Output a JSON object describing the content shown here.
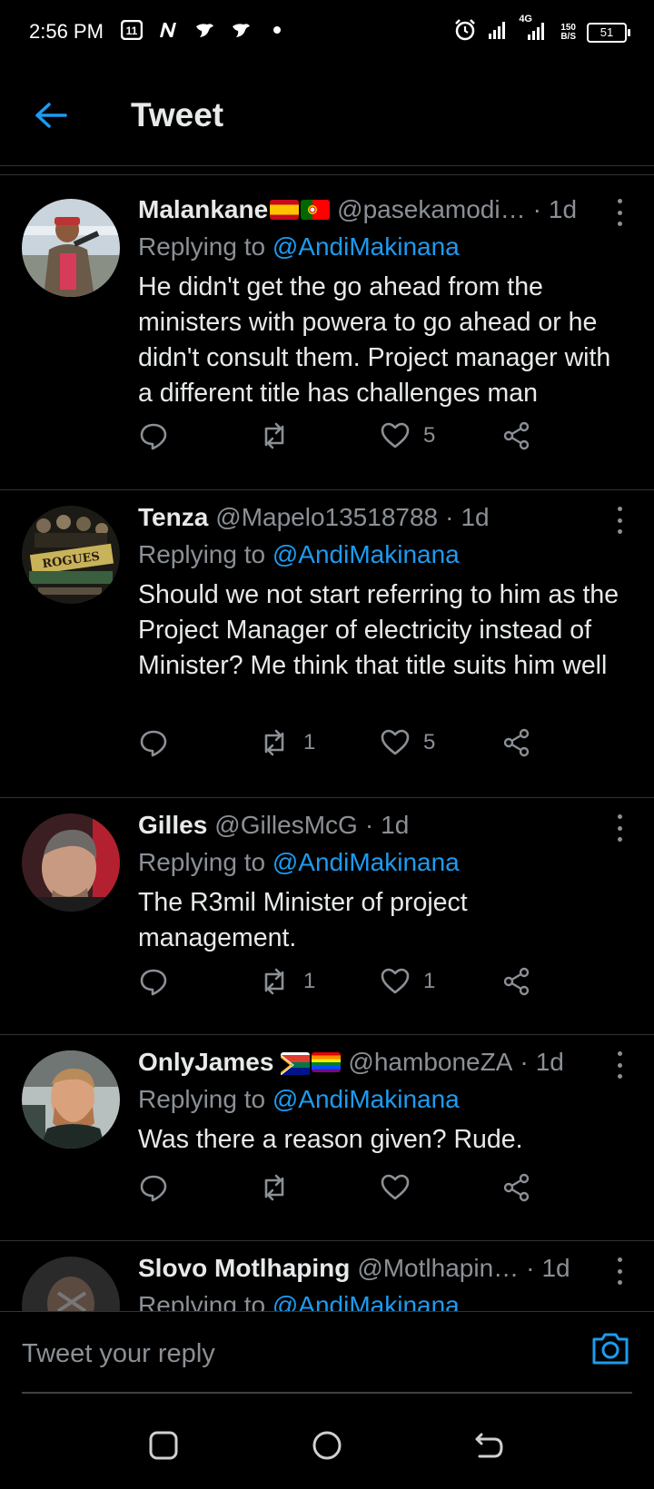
{
  "status_bar": {
    "time": "2:56 PM",
    "network": "4G",
    "net_speed_top": "150",
    "net_speed_bottom": "B/S",
    "battery": "51",
    "icons": [
      "app-notification-icon",
      "n-notification-icon",
      "bird-notification-icon",
      "bird-notification-icon",
      "dot-icon",
      "alarm-icon",
      "signal-icon",
      "signal-4g-icon",
      "battery-icon"
    ]
  },
  "header": {
    "title": "Tweet",
    "back_icon": "back-arrow-icon"
  },
  "colors": {
    "background": "#000000",
    "accent": "#1d9bf0",
    "secondary_text": "#8b9096",
    "divider": "#2f3336"
  },
  "tweets": [
    {
      "name": "Malankane",
      "flags": [
        "spain-flag",
        "portugal-flag"
      ],
      "handle": "@pasekamodi…",
      "age": "1d",
      "reply_prefix": "Replying to",
      "reply_to": "@AndiMakinana",
      "text": "He didn't get the go ahead from the ministers with powera to go ahead or he didn't consult them. Project manager with a different title has challenges man",
      "replies": "",
      "retweets": "",
      "likes": "5"
    },
    {
      "name": "Tenza",
      "flags": [],
      "handle": "@Mapelo13518788",
      "age": "1d",
      "reply_prefix": "Replying to",
      "reply_to": "@AndiMakinana",
      "text": "Should we not start referring to him as the Project Manager of electricity instead of Minister? Me think that title suits him well",
      "replies": "",
      "retweets": "1",
      "likes": "5"
    },
    {
      "name": "Gilles",
      "flags": [],
      "handle": "@GillesMcG",
      "age": "1d",
      "reply_prefix": "Replying to",
      "reply_to": "@AndiMakinana",
      "text": "The R3mil Minister of project management.",
      "replies": "",
      "retweets": "1",
      "likes": "1"
    },
    {
      "name": "OnlyJames",
      "flags": [
        "south-africa-flag",
        "rainbow-flag"
      ],
      "handle": "@hamboneZA",
      "age": "1d",
      "reply_prefix": "Replying to",
      "reply_to": "@AndiMakinana",
      "text": "Was there a reason given? Rude.",
      "replies": "",
      "retweets": "",
      "likes": ""
    },
    {
      "name": "Slovo Motlhaping",
      "flags": [],
      "handle": "@Motlhapin…",
      "age": "1d",
      "reply_prefix": "Replying to",
      "reply_to": "@AndiMakinana",
      "text": "",
      "replies": "",
      "retweets": "",
      "likes": ""
    }
  ],
  "composer": {
    "placeholder": "Tweet your reply",
    "camera_icon": "camera-icon"
  },
  "nav_bar": {
    "buttons": [
      "recents-square-icon",
      "home-circle-icon",
      "back-return-icon"
    ]
  }
}
